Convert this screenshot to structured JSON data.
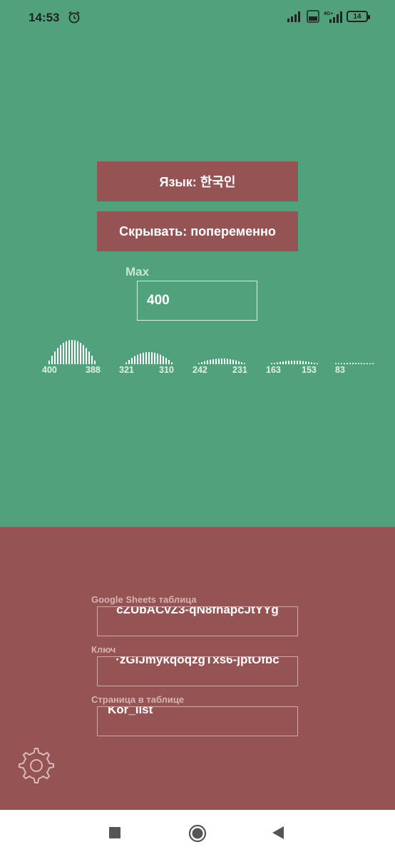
{
  "status_bar": {
    "time": "14:53",
    "battery": "14",
    "network": "4G+"
  },
  "settings": {
    "language_button": "Язык: 한국인",
    "hide_button": "Скрывать: попеременно",
    "max_label": "Max",
    "max_value": "400"
  },
  "histogram": {
    "labels": [
      "400",
      "388",
      "321",
      "310",
      "242",
      "231",
      "163",
      "153",
      "83"
    ]
  },
  "sheets": {
    "sheet_label": "Google Sheets таблица",
    "sheet_value": "cZUbACvZ3-qN8fnapcJtYYg",
    "key_label": "Ключ",
    "key_value": "·zGIJmykqoqzgTxs6-jptOfbc",
    "page_label": "Страница в таблице",
    "page_value": "Kor_list"
  },
  "icons": {
    "alarm": "alarm-icon",
    "settings": "gear-icon",
    "nav_recent": "square-icon",
    "nav_home": "circle-icon",
    "nav_back": "triangle-back-icon"
  }
}
